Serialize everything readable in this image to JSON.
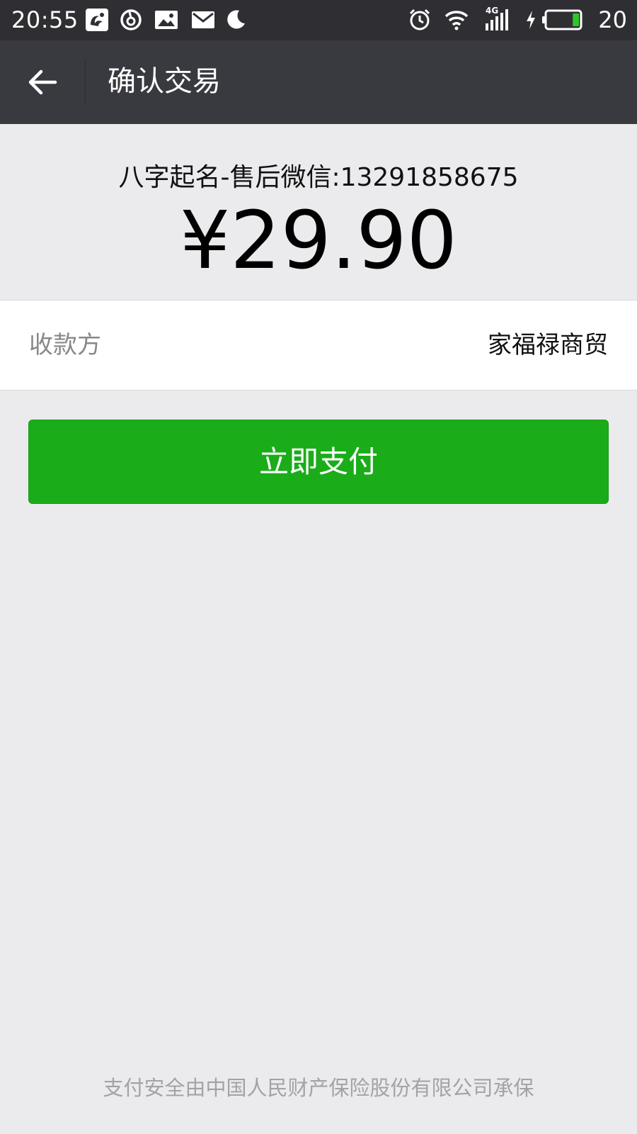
{
  "status_bar": {
    "time": "20:55",
    "battery_percent": "20",
    "network": "4G",
    "left_icons": [
      "uc-browser-icon",
      "netease-music-icon",
      "image-notification-icon",
      "mail-icon",
      "moon-icon"
    ],
    "right_icons": [
      "alarm-icon",
      "wifi-icon",
      "cellular-signal-icon",
      "charging-icon",
      "battery-icon"
    ],
    "battery_level": 0.2
  },
  "app_bar": {
    "back_icon": "arrow-left-icon",
    "title": "确认交易"
  },
  "summary": {
    "description": "八字起名-售后微信:13291858675",
    "amount": "¥29.90"
  },
  "payee": {
    "label": "收款方",
    "value": "家福禄商贸"
  },
  "pay_button": {
    "label": "立即支付"
  },
  "footer": {
    "note": "支付安全由中国人民财产保险股份有限公司承保"
  },
  "colors": {
    "status_bar_bg": "#2e2e33",
    "app_bar_bg": "#393a3f",
    "page_bg": "#ebebed",
    "accent_green": "#1aad19",
    "battery_green": "#2ec52d"
  }
}
